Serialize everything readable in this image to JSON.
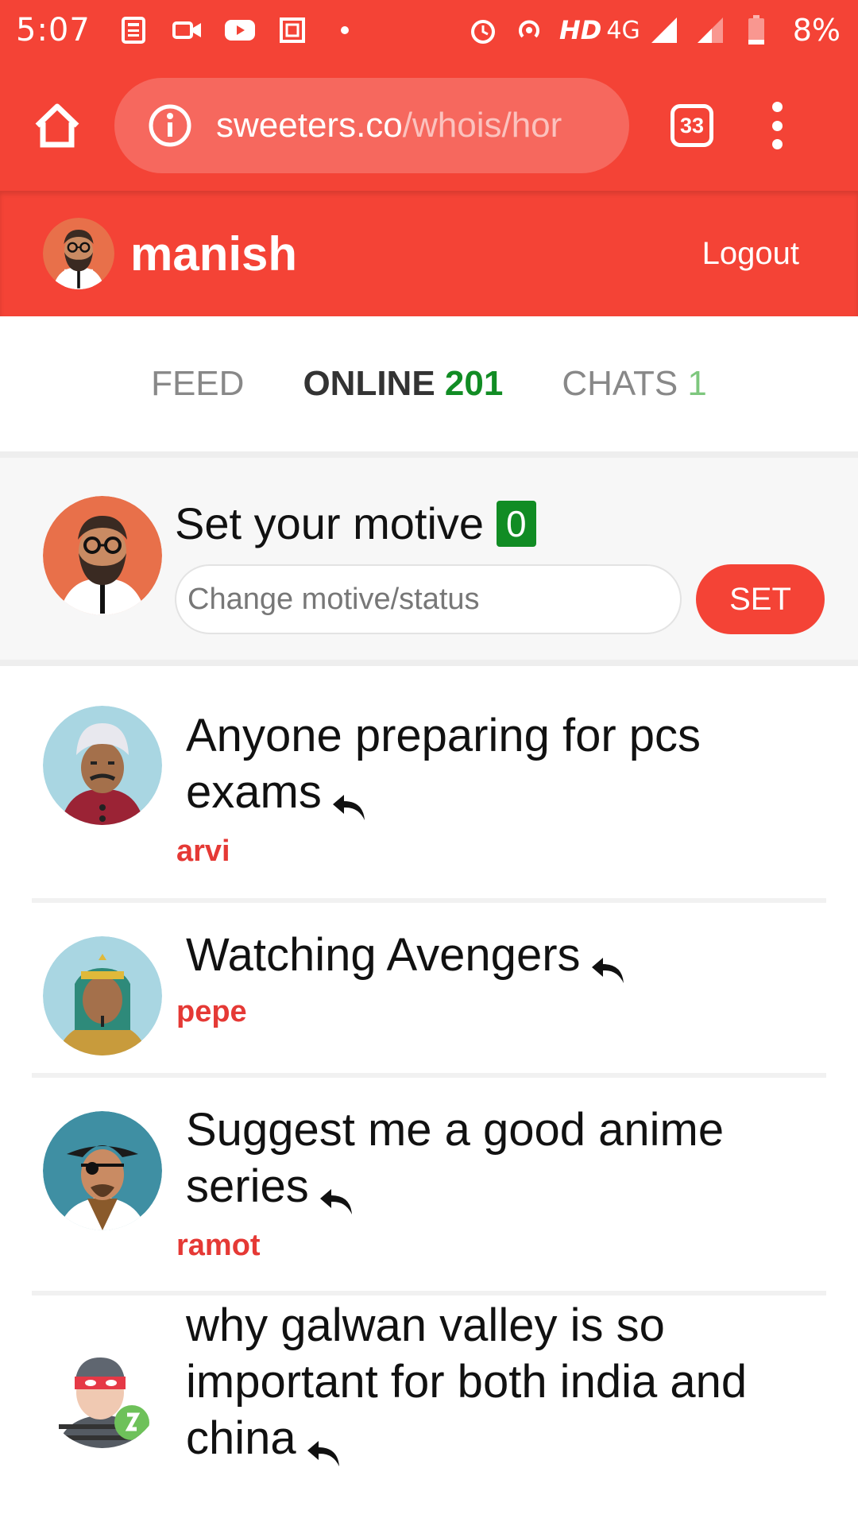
{
  "status_bar": {
    "time": "5:07",
    "hd": "HD",
    "network": "4G",
    "battery": "8%"
  },
  "browser": {
    "url_domain": "sweeters.co",
    "url_path": "/whois/hor",
    "tab_count": "33"
  },
  "header": {
    "username": "manish",
    "logout_label": "Logout"
  },
  "tabs": [
    {
      "label": "FEED",
      "count": ""
    },
    {
      "label": "ONLINE",
      "count": "201"
    },
    {
      "label": "CHATS",
      "count": "1"
    }
  ],
  "motive": {
    "title": "Set your motive",
    "badge": "0",
    "input_placeholder": "Change motive/status",
    "input_value": "",
    "set_label": "SET"
  },
  "posts": [
    {
      "text": "Anyone preparing for pcs exams",
      "author": "arvi"
    },
    {
      "text": "Watching Avengers",
      "author": "pepe"
    },
    {
      "text": "Suggest me a good anime series",
      "author": "ramot"
    },
    {
      "text": "why galwan valley is so important for both india and china",
      "author": ""
    }
  ],
  "colors": {
    "brand_red": "#f44336",
    "author_red": "#e53935",
    "online_green": "#118c24",
    "chats_green": "#7ec77e"
  }
}
